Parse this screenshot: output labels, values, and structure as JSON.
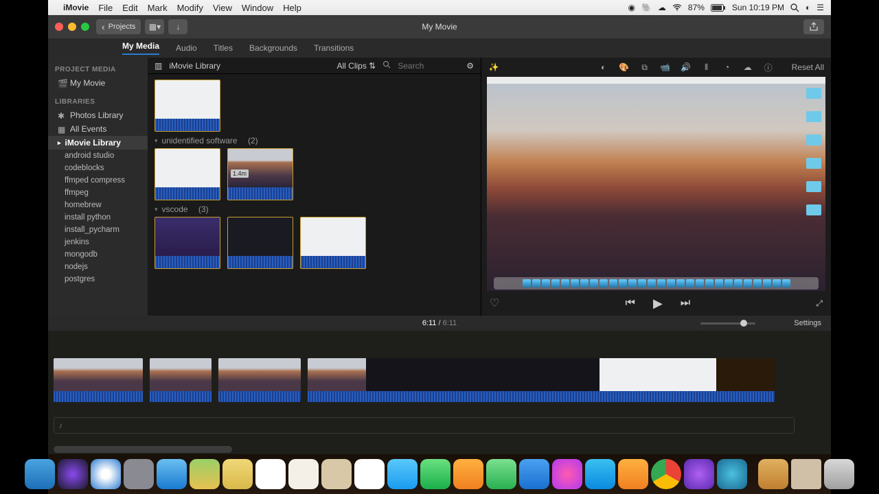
{
  "menubar": {
    "app": "iMovie",
    "menus": [
      "File",
      "Edit",
      "Mark",
      "Modify",
      "View",
      "Window",
      "Help"
    ],
    "battery": "87%",
    "datetime": "Sun 10:19 PM"
  },
  "window": {
    "title": "My Movie",
    "back_label": "Projects"
  },
  "tabs": [
    "My Media",
    "Audio",
    "Titles",
    "Backgrounds",
    "Transitions"
  ],
  "active_tab": "My Media",
  "sidebar": {
    "project_media_hdr": "PROJECT MEDIA",
    "project": "My Movie",
    "libraries_hdr": "LIBRARIES",
    "photos": "Photos Library",
    "all_events": "All Events",
    "imovie_lib": "iMovie Library",
    "events": [
      "android studio",
      "codeblocks",
      "ffmped compress",
      "ffmpeg",
      "homebrew",
      "install python",
      "install_pycharm",
      "jenkins",
      "mongodb",
      "nodejs",
      "postgres"
    ]
  },
  "browser": {
    "library_label": "iMovie Library",
    "filter": "All Clips",
    "search_placeholder": "Search",
    "groups": [
      {
        "name": "unidentified software",
        "count": "(2)",
        "badge": "1.4m"
      },
      {
        "name": "vscode",
        "count": "(3)"
      }
    ]
  },
  "viewer": {
    "reset": "Reset All"
  },
  "playhead": {
    "current": "6:11",
    "total": "6:11",
    "settings": "Settings"
  },
  "dock_apps": [
    "finder",
    "siri",
    "safari",
    "launchpad",
    "mail",
    "maps",
    "notes",
    "calendar",
    "reminders",
    "photos",
    "messages",
    "facetime",
    "pages",
    "numbers",
    "keynote",
    "itunes",
    "appstore",
    "ibooks",
    "chrome",
    "imovie",
    "quicktime"
  ]
}
